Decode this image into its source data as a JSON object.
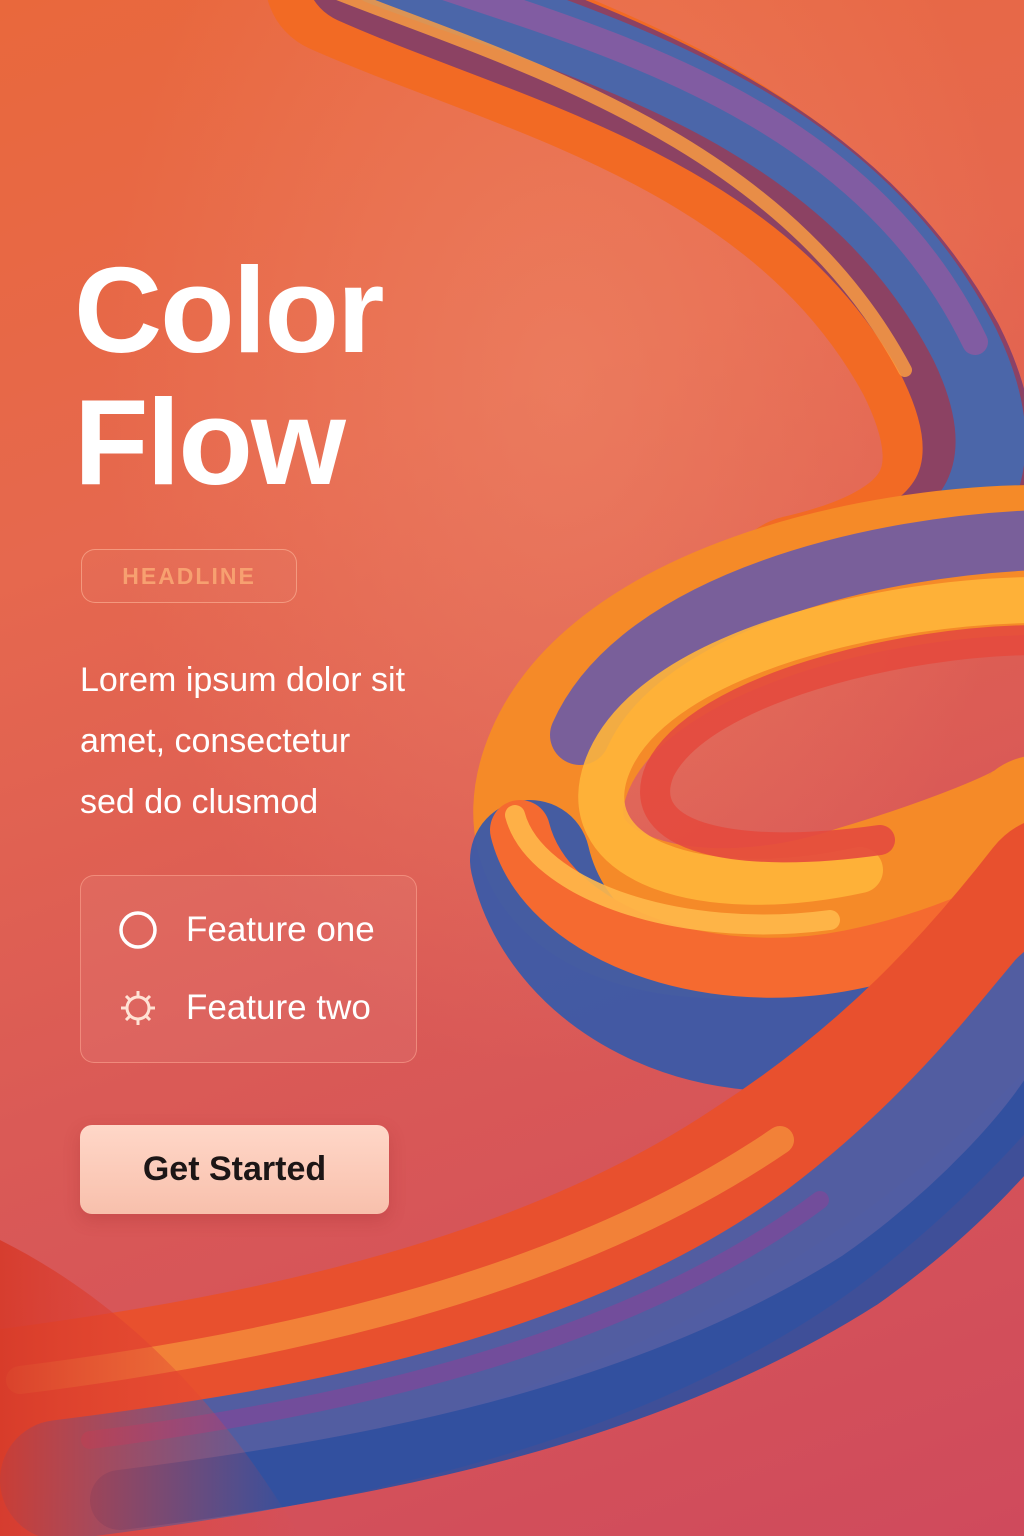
{
  "hero": {
    "title_line1": "Color",
    "title_line2": "Flow",
    "badge": "HEADLINE",
    "description_lines": [
      "Lorem ipsum dolor sit",
      "amet, consectetur",
      "sed do clusmod"
    ]
  },
  "features": [
    {
      "label": "Feature one",
      "icon": "circle-icon"
    },
    {
      "label": "Feature two",
      "icon": "gear-icon"
    }
  ],
  "cta": {
    "label": "Get Started"
  },
  "colors": {
    "background_top": "#e9683c",
    "background_bottom": "#cf4a5c",
    "badge_text": "#f7a070",
    "button_fill": "#ffd7c8",
    "button_text": "#1c1616"
  }
}
